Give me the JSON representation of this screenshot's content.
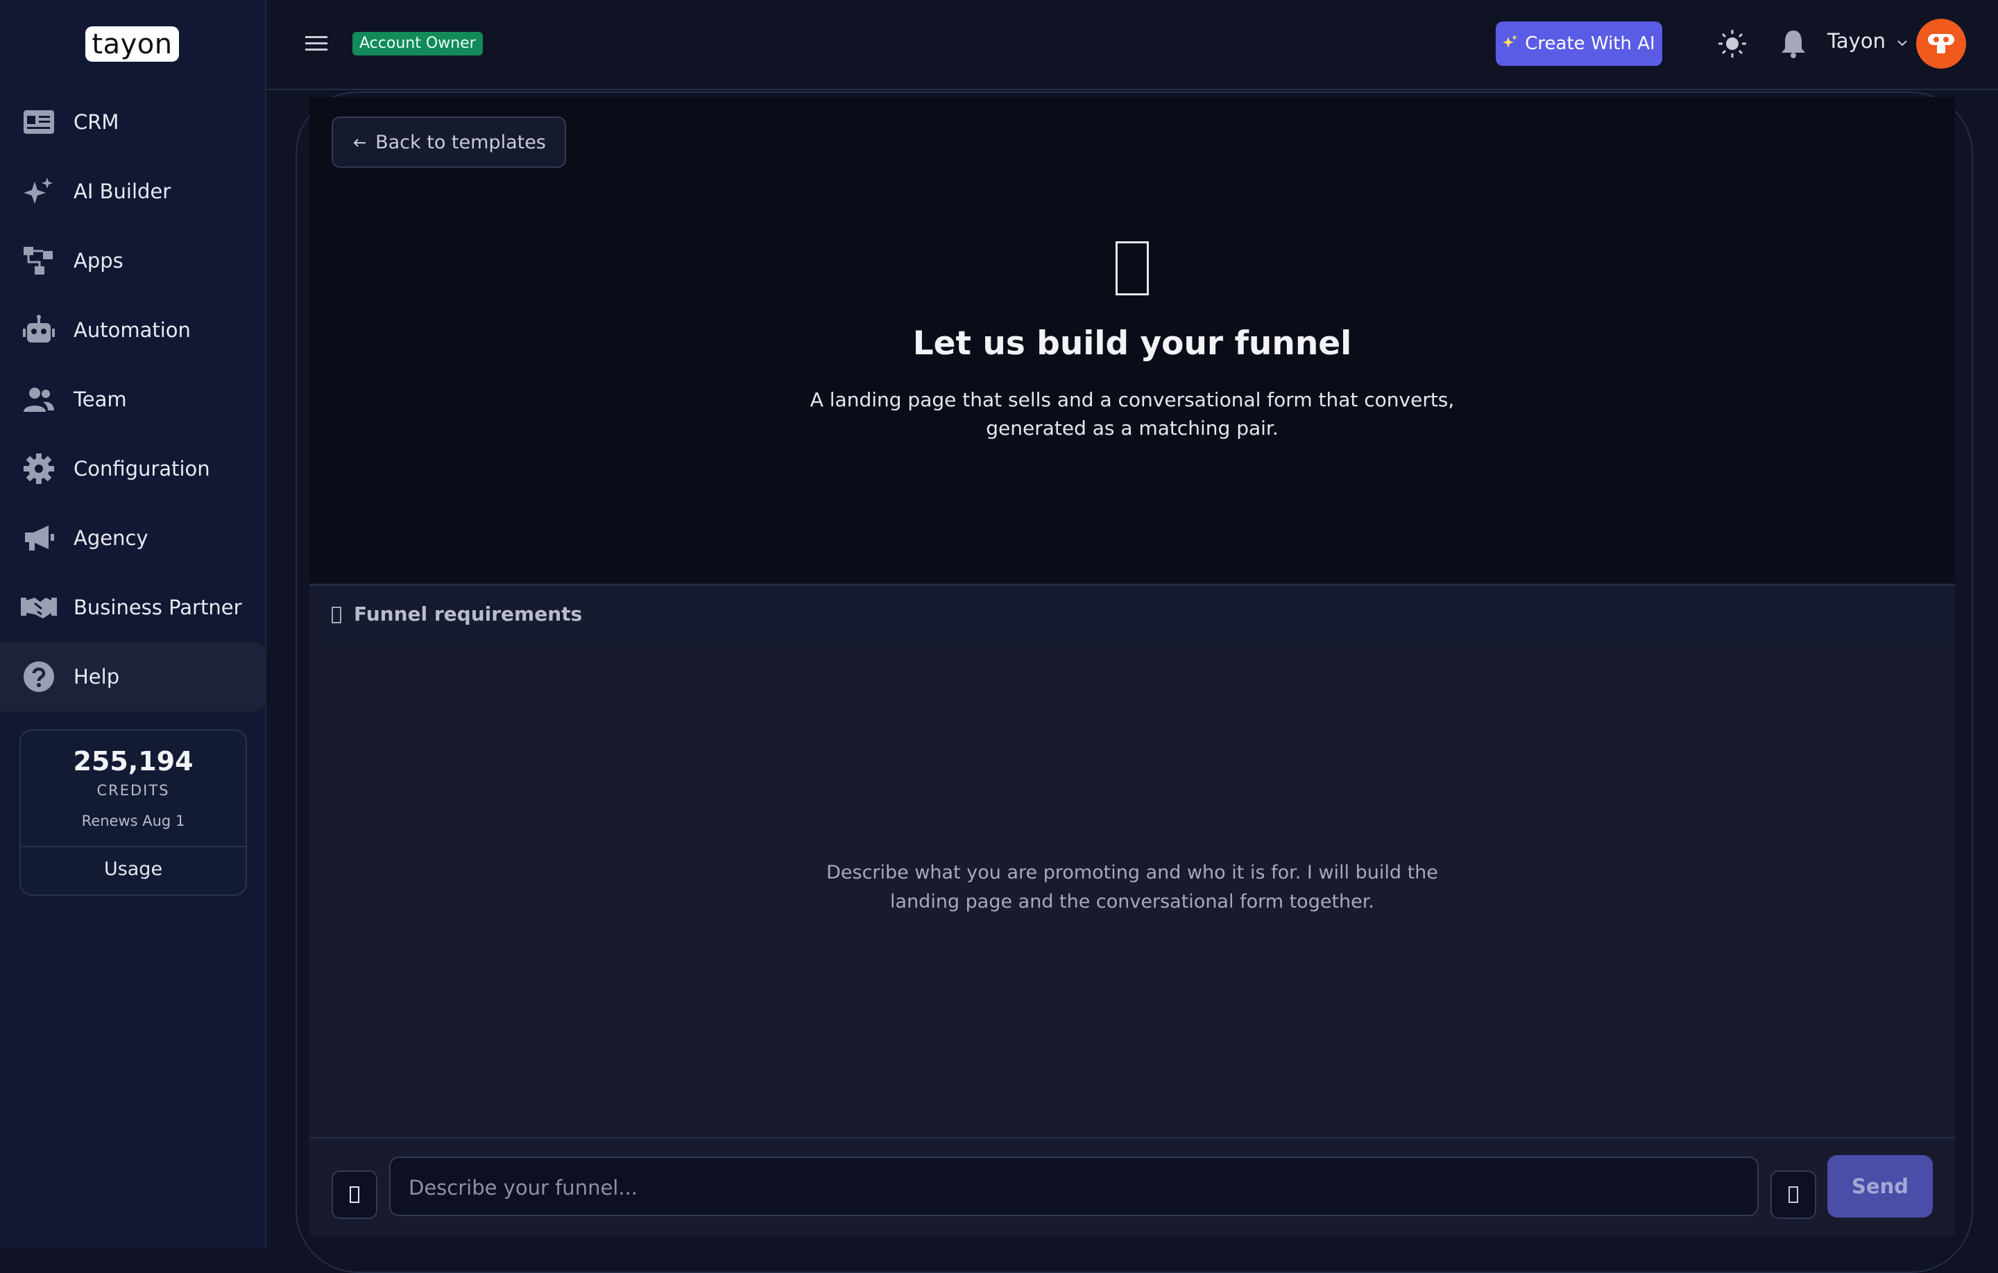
{
  "brand": {
    "logo_text": "tayon"
  },
  "sidebar": {
    "items": [
      {
        "label": "CRM",
        "icon": "id-card-icon"
      },
      {
        "label": "AI Builder",
        "icon": "sparkles-icon"
      },
      {
        "label": "Apps",
        "icon": "sitemap-icon"
      },
      {
        "label": "Automation",
        "icon": "robot-icon"
      },
      {
        "label": "Team",
        "icon": "users-icon"
      },
      {
        "label": "Configuration",
        "icon": "gear-icon"
      },
      {
        "label": "Agency",
        "icon": "megaphone-icon"
      },
      {
        "label": "Business Partner",
        "icon": "handshake-icon"
      },
      {
        "label": "Help",
        "icon": "question-circle-icon",
        "active": true
      }
    ]
  },
  "credits": {
    "amount": "255,194",
    "caption": "CREDITS",
    "renews": "Renews Aug 1",
    "usage_label": "Usage"
  },
  "header": {
    "role_badge": "Account Owner",
    "create_label": "Create With AI",
    "user_name": "Tayon",
    "colors": {
      "accent": "#5b5ce6",
      "badge": "#138a5a",
      "avatar": "#f05a1c"
    }
  },
  "hero": {
    "back_label": "Back to templates",
    "title": "Let us build your funnel",
    "subtitle": "A landing page that sells and a conversational form that converts, generated as a matching pair."
  },
  "requirements": {
    "label": "Funnel requirements"
  },
  "chat": {
    "hint": "Describe what you are promoting and who it is for. I will build the landing page and the conversational form together."
  },
  "composer": {
    "placeholder": "Describe your funnel...",
    "send_label": "Send"
  }
}
